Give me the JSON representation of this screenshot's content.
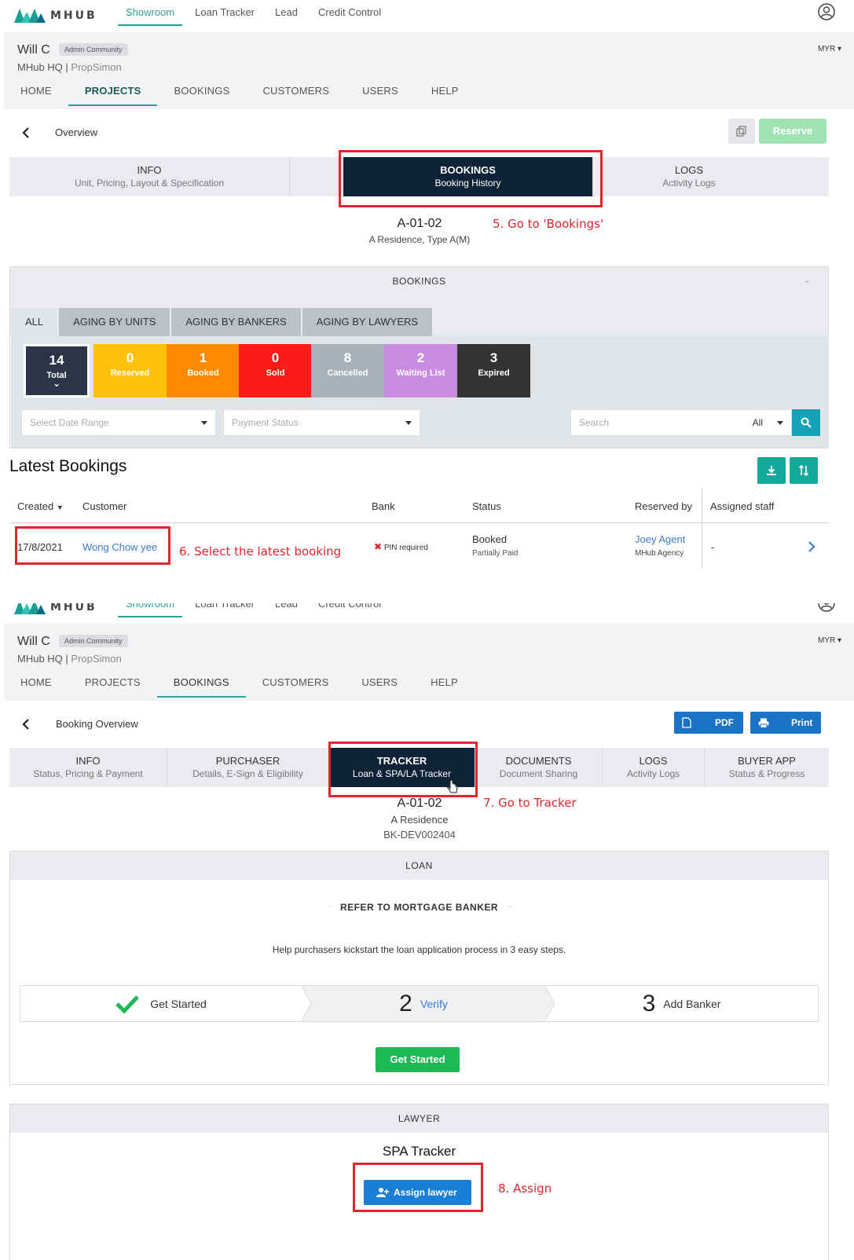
{
  "brand": {
    "logo_text": "MHUB"
  },
  "topnav": [
    "Showroom",
    "Loan Tracker",
    "Lead",
    "Credit Control"
  ],
  "user": {
    "name": "Will C",
    "badge": "Admin Community",
    "org": "MHub HQ",
    "org_sep": " | ",
    "org_sub": "PropSimon",
    "currency": "MYR"
  },
  "mainnav": [
    "HOME",
    "PROJECTS",
    "BOOKINGS",
    "CUSTOMERS",
    "USERS",
    "HELP"
  ],
  "p1": {
    "back_title": "Overview",
    "reserve": "Reserve",
    "tabs": [
      {
        "t1": "INFO",
        "t2": "Unit, Pricing, Layout & Specification"
      },
      {
        "t1": "BOOKINGS",
        "t2": "Booking History"
      },
      {
        "t1": "LOGS",
        "t2": "Activity Logs"
      }
    ],
    "annot5": "5. Go to 'Bookings'",
    "unit": "A-01-02",
    "unit_sub": "A Residence, Type A(M)",
    "section": "BOOKINGS",
    "subtabs": [
      "ALL",
      "AGING BY UNITS",
      "AGING BY BANKERS",
      "AGING BY LAWYERS"
    ],
    "stats": [
      {
        "n": "14",
        "l": "Total",
        "color": "#2b3547"
      },
      {
        "n": "0",
        "l": "Reserved",
        "color": "#ffc107"
      },
      {
        "n": "1",
        "l": "Booked",
        "color": "#ff8a00"
      },
      {
        "n": "0",
        "l": "Sold",
        "color": "#ff1a1a"
      },
      {
        "n": "8",
        "l": "Cancelled",
        "color": "#a9b2bb"
      },
      {
        "n": "2",
        "l": "Waiting List",
        "color": "#c78be0"
      },
      {
        "n": "3",
        "l": "Expired",
        "color": "#333333"
      }
    ],
    "date_range": "Select Date Range",
    "payment_status": "Payment Status",
    "search": "Search",
    "search_scope": "All",
    "latest": "Latest Bookings",
    "columns": [
      "Created",
      "Customer",
      "Bank",
      "Status",
      "Reserved by",
      "Assigned staff"
    ],
    "row": {
      "created": "17/8/2021",
      "customer": "Wong Chow yee",
      "bank": "PIN required",
      "status": "Booked",
      "status_sub": "Partially Paid",
      "reserved_by": "Joey Agent",
      "agency": "MHub Agency",
      "staff": "-"
    },
    "annot6": "6. Select the latest booking"
  },
  "p2": {
    "back_title": "Booking Overview",
    "pdf": "PDF",
    "print": "Print",
    "tabs": [
      {
        "t1": "INFO",
        "t2": "Status, Pricing & Payment"
      },
      {
        "t1": "PURCHASER",
        "t2": "Details, E-Sign & Eligibility"
      },
      {
        "t1": "TRACKER",
        "t2": "Loan & SPA/LA Tracker"
      },
      {
        "t1": "DOCUMENTS",
        "t2": "Document Sharing"
      },
      {
        "t1": "LOGS",
        "t2": "Activity Logs"
      },
      {
        "t1": "BUYER APP",
        "t2": "Status & Progress"
      }
    ],
    "annot7": "7. Go to Tracker",
    "unit": "A-01-02",
    "unit_sub": "A Residence",
    "booking_id": "BK-DEV002404",
    "loan": "LOAN",
    "refer": "REFER TO MORTGAGE BANKER",
    "help": "Help purchasers kickstart the loan application process in 3 easy steps.",
    "steps": [
      {
        "num": "",
        "label": "Get Started"
      },
      {
        "num": "2",
        "label": "Verify"
      },
      {
        "num": "3",
        "label": "Add Banker"
      }
    ],
    "get_started": "Get Started",
    "lawyer": "LAWYER",
    "spa": "SPA Tracker",
    "assign": "Assign lawyer",
    "annot8": "8. Assign"
  }
}
